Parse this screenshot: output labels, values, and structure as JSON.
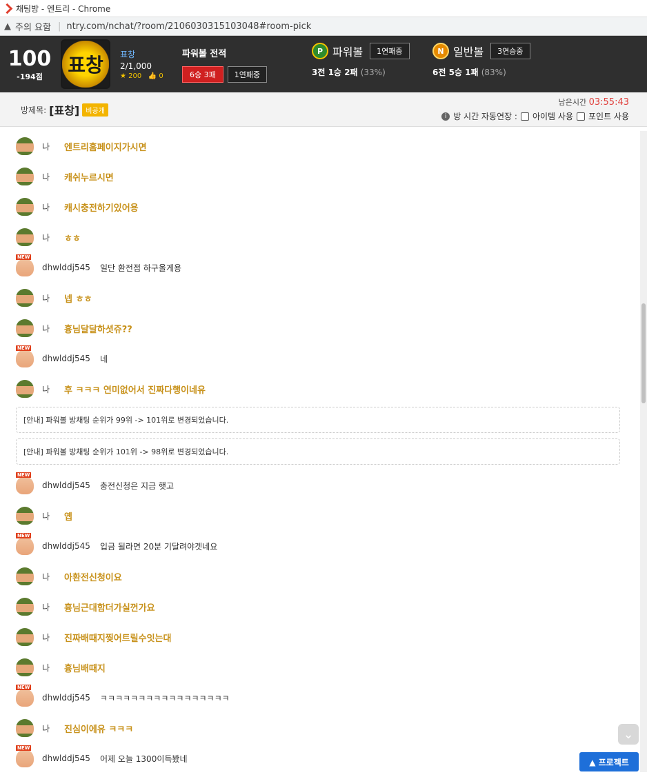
{
  "browser": {
    "window_title": "채팅방 - 엔트리 - Chrome",
    "security_label": "주의 요함",
    "url": "ntry.com/nchat/?room/2106030315103048#room-pick"
  },
  "header": {
    "score": "100",
    "score_sub": "-194점",
    "badge_text": "표창",
    "nickname": "표창",
    "rank_current": "2",
    "rank_total": "/1,000",
    "stars": "200",
    "likes": "0",
    "record_title": "파워볼 전적",
    "record_result": "6승 3패",
    "record_streak": "1연패중",
    "powerball": {
      "coin": "P",
      "name": "파워볼",
      "streak": "1연패중",
      "result": "3전 1승 2패",
      "pct": "(33%)"
    },
    "normalball": {
      "coin": "N",
      "name": "일반볼",
      "streak": "3연승중",
      "result": "6전 5승 1패",
      "pct": "(83%)"
    }
  },
  "room": {
    "label": "방제목:",
    "name": "[표창]",
    "tag": "비공개",
    "remain_label": "남은시간",
    "remain_time": "03:55:43",
    "auto_extend": "방 시간 자동연장 :",
    "item_use": "아이템 사용",
    "point_use": "포인트 사용"
  },
  "chat": [
    {
      "type": "me",
      "nick": "나",
      "text": "엔트리홈페이지가시면"
    },
    {
      "type": "me",
      "nick": "나",
      "text": "캐쉬누르시면"
    },
    {
      "type": "me",
      "nick": "나",
      "text": "캐시충전하기있어용"
    },
    {
      "type": "me",
      "nick": "나",
      "text": "ㅎㅎ"
    },
    {
      "type": "other",
      "nick": "dhwlddj545",
      "text": "일단 환전점 하구올게용"
    },
    {
      "type": "me",
      "nick": "나",
      "text": "넵 ㅎㅎ"
    },
    {
      "type": "me",
      "nick": "나",
      "text": "흉님달달하셧쥬??"
    },
    {
      "type": "other",
      "nick": "dhwlddj545",
      "text": "네"
    },
    {
      "type": "me",
      "nick": "나",
      "text": "후 ㅋㅋㅋ 연미없어서 진짜다행이네유"
    },
    {
      "type": "notice",
      "text": "[안내] 파워볼 방채팅 순위가 99위 -> 101위로 변경되었습니다."
    },
    {
      "type": "notice",
      "text": "[안내] 파워볼 방채팅 순위가 101위 -> 98위로 변경되었습니다."
    },
    {
      "type": "other",
      "nick": "dhwlddj545",
      "text": "충전신청은 지금 햇고"
    },
    {
      "type": "me",
      "nick": "나",
      "text": "옙"
    },
    {
      "type": "other",
      "nick": "dhwlddj545",
      "text": "입금 될라면 20분 기달려야겟네요"
    },
    {
      "type": "me",
      "nick": "나",
      "text": "아환전신청이요"
    },
    {
      "type": "me",
      "nick": "나",
      "text": "흉님근대함더가실껀가요"
    },
    {
      "type": "me",
      "nick": "나",
      "text": "진짜배때지찢어트릴수잇는대"
    },
    {
      "type": "me",
      "nick": "나",
      "text": "흉님배때지"
    },
    {
      "type": "other",
      "nick": "dhwlddj545",
      "text": "ㅋㅋㅋㅋㅋㅋㅋㅋㅋㅋㅋㅋㅋㅋㅋㅋㅋ"
    },
    {
      "type": "me",
      "nick": "나",
      "text": "진심이에유 ㅋㅋㅋ"
    },
    {
      "type": "other",
      "nick": "dhwlddj545",
      "text": "어제 오늘 1300이득봤네"
    }
  ],
  "protect_label": "▲ 프로젝트"
}
